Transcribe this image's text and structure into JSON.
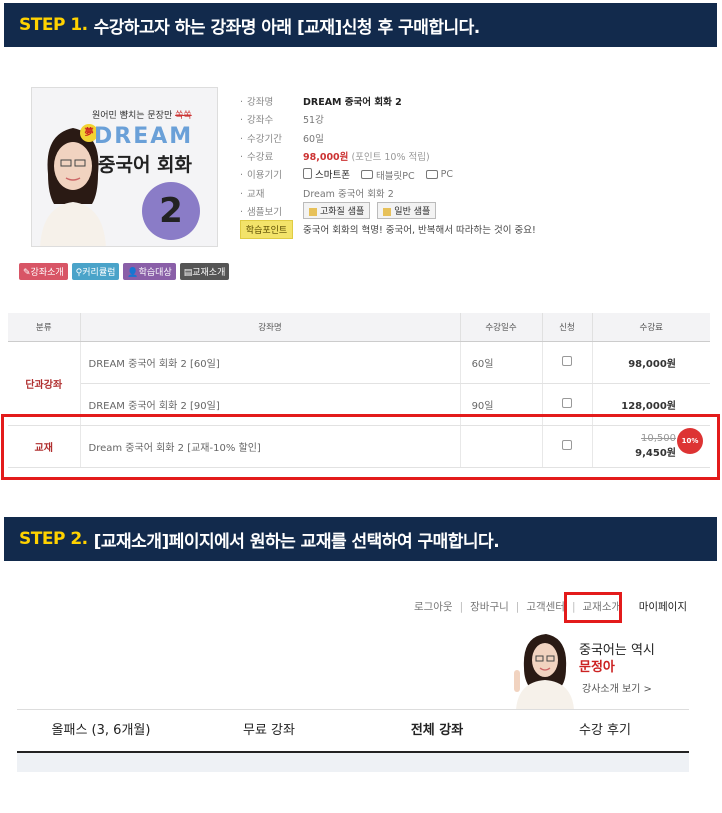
{
  "step1": {
    "num": "STEP 1.",
    "text": "수강하고자 하는 강좌명 아래 [교재]신청 후 구매합니다."
  },
  "step2": {
    "num": "STEP 2.",
    "text": "[교재소개]페이지에서 원하는 교재를 선택하여 구매합니다."
  },
  "thumbnail": {
    "slogan": "원어민 뺨치는 문장만",
    "slogan_strike": "쏙쏙",
    "mark": "夢",
    "brand": "DREAM",
    "title": "중국어 회화",
    "level": "2"
  },
  "course_info": {
    "labels": {
      "name": "강좌명",
      "lectures": "강좌수",
      "period": "수강기간",
      "fee": "수강료",
      "devices": "이용기기",
      "book": "교재",
      "samples": "샘플보기"
    },
    "name": "DREAM 중국어 회화 2",
    "lectures": "51강",
    "period": "60일",
    "fee": "98,000원",
    "fee_note": "(포인트 10% 적립)",
    "devices": [
      "스마트폰",
      "태블릿PC",
      "PC"
    ],
    "book": "Dream 중국어 회화 2",
    "sample_buttons": [
      "고화질 샘플",
      "일반 샘플"
    ],
    "point_label": "학습포인트",
    "point_text": "중국어 회화의 혁명! 중국어, 반복해서 따라하는 것이 중요!"
  },
  "tags": [
    {
      "label": "강좌소개",
      "color": "#d85566"
    },
    {
      "label": "커리큘럼",
      "color": "#4aa3c9"
    },
    {
      "label": "학습대상",
      "color": "#8a5fa8"
    },
    {
      "label": "교재소개",
      "color": "#555555"
    }
  ],
  "table": {
    "headers": [
      "분류",
      "강좌명",
      "수강일수",
      "신청",
      "수강료"
    ],
    "group1": "단과강좌",
    "rows": [
      {
        "name": "DREAM 중국어 회화 2 [60일]",
        "days": "60일",
        "fee": "98,000원"
      },
      {
        "name": "DREAM 중국어 회화 2 [90일]",
        "days": "90일",
        "fee": "128,000원"
      }
    ],
    "book_row": {
      "category": "교재",
      "name": "Dream 중국어 회화 2 [교재-10% 할인]",
      "old_fee": "10,500",
      "fee": "9,450원",
      "badge": "10%"
    }
  },
  "topnav": [
    "로그아웃",
    "장바구니",
    "고객센터",
    "교재소개",
    "마이페이지"
  ],
  "promo": {
    "line1": "중국어는 역시",
    "line2": "문정아",
    "line3": "강사소개 보기 >"
  },
  "menu": [
    "올패스 (3, 6개월)",
    "무료 강좌",
    "전체 강좌",
    "수강 후기"
  ],
  "colors": {
    "banner": "#122a4c",
    "step_num": "#ffd200",
    "highlight": "#e31b1b"
  }
}
